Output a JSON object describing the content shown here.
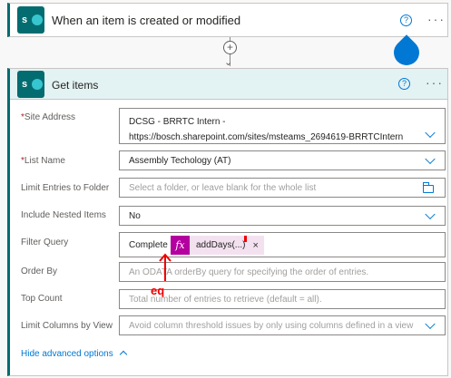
{
  "trigger": {
    "icon": "sharepoint-icon",
    "icon_letter": "s",
    "title": "When an item is created or modified",
    "help": "?",
    "more": "···"
  },
  "connector": {
    "add": "+",
    "arrow": "⌄"
  },
  "action": {
    "icon": "sharepoint-icon",
    "icon_letter": "s",
    "title": "Get items",
    "help": "?",
    "more": "···",
    "site_address": {
      "label": "Site Address",
      "required": "*",
      "line1": "DCSG - BRRTC Intern -",
      "line2": "https://bosch.sharepoint.com/sites/msteams_2694619-BRRTCIntern"
    },
    "list_name": {
      "label": "List Name",
      "required": "*",
      "value": "Assembly Techology (AT)"
    },
    "limit_folder": {
      "label": "Limit Entries to Folder",
      "placeholder": "Select a folder, or leave blank for the whole list"
    },
    "nested": {
      "label": "Include Nested Items",
      "value": "No"
    },
    "filter_query": {
      "label": "Filter Query",
      "text": "Complete",
      "token_icon": "fx",
      "token_label": "addDays(...)",
      "token_remove": "×"
    },
    "order_by": {
      "label": "Order By",
      "placeholder": "An ODATA orderBy query for specifying the order of entries."
    },
    "top_count": {
      "label": "Top Count",
      "placeholder": "Total number of entries to retrieve (default = all)."
    },
    "limit_columns": {
      "label": "Limit Columns by View",
      "placeholder": "Avoid column threshold issues by only using columns defined in a view"
    },
    "hide_advanced": "Hide advanced options"
  },
  "annotation": {
    "text": "eq",
    "color": "#e00000"
  },
  "colors": {
    "brand": "#036c70",
    "accent": "#0078d4",
    "token_fx": "#b4009e"
  }
}
